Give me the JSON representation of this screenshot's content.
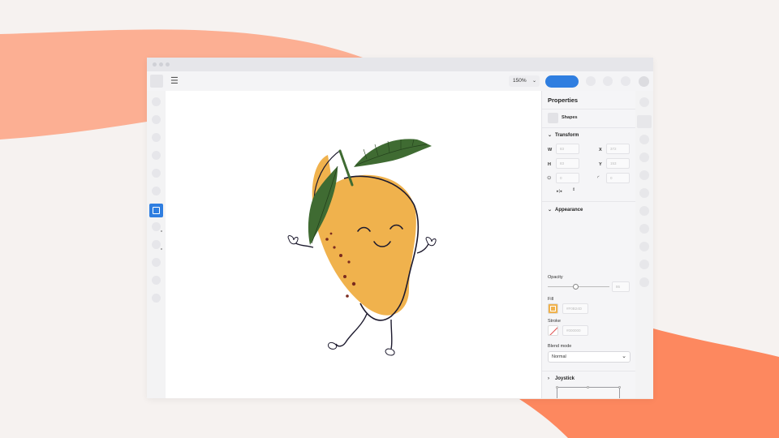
{
  "toolbar": {
    "zoom": "150%",
    "menu_icon": "hamburger-icon"
  },
  "panel": {
    "title": "Properties",
    "selection_label": "Shapes",
    "transform": {
      "label": "Transform",
      "w_label": "W",
      "h_label": "H",
      "x_label": "X",
      "y_label": "Y",
      "w_value": "83",
      "h_value": "83",
      "x_value": "372",
      "y_value": "153",
      "rotation_value": "0",
      "radius_value": "0"
    },
    "appearance": {
      "label": "Appearance",
      "opacity_label": "Opacity",
      "opacity_value": "86",
      "opacity_fraction": 0.46,
      "fill_label": "Fill",
      "fill_value": "#F0B24D",
      "fill_color": "#f0b24d",
      "stroke_label": "Stroke",
      "stroke_value": "#000000",
      "blend_label": "Blend mode",
      "blend_value": "Normal"
    },
    "joystick": {
      "label": "Joystick"
    }
  },
  "colors": {
    "accent": "#2f7ee0",
    "mango": "#f0b24d",
    "leaf": "#3f6b32",
    "knob": "#8a45c6"
  }
}
